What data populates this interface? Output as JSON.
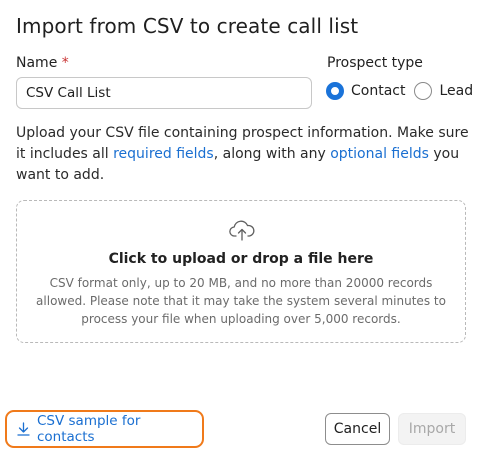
{
  "dialog": {
    "title": "Import from CSV to create call list"
  },
  "name_field": {
    "label": "Name",
    "required_mark": "*",
    "value": "CSV Call List"
  },
  "prospect_type": {
    "label": "Prospect type",
    "options": [
      {
        "label": "Contact",
        "selected": true
      },
      {
        "label": "Lead",
        "selected": false
      }
    ]
  },
  "description": {
    "part1": "Upload your CSV file containing prospect information. Make sure it includes all ",
    "link1": "required fields",
    "part2": ", along with any ",
    "link2": "optional fields",
    "part3": " you want to add."
  },
  "dropzone": {
    "icon": "cloud-upload-icon",
    "title": "Click to upload or drop a file here",
    "hint": "CSV format only, up to 20 MB, and no more than 20000 records allowed. Please note that it may take the system several minutes to process your file when uploading over 5,000 records."
  },
  "footer": {
    "sample_icon": "download-icon",
    "sample_link": "CSV sample for contacts",
    "cancel_label": "Cancel",
    "import_label": "Import",
    "import_disabled": true
  },
  "colors": {
    "accent": "#1a73d9",
    "link": "#1a6fd1",
    "highlight": "#f07a1a",
    "required": "#c83232"
  }
}
